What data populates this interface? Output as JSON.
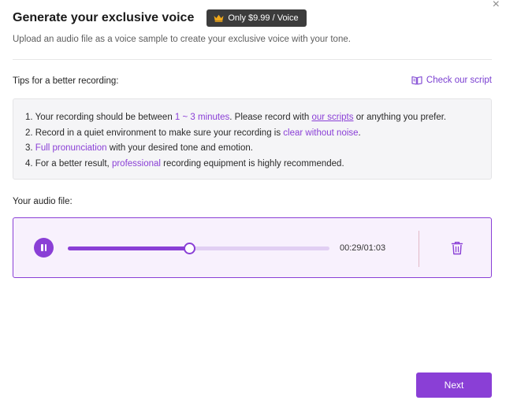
{
  "dialog": {
    "title": "Generate your exclusive voice",
    "price_badge": "Only $9.99 / Voice",
    "subtitle": "Upload an audio file as a voice sample to create your exclusive voice with your tone.",
    "close_glyph": "×"
  },
  "tips": {
    "label": "Tips for a better recording:",
    "script_link": "Check our script",
    "items": [
      {
        "n": "1.",
        "a": "Your recording should be between ",
        "hl": "1 ~ 3 minutes",
        "b": ". Please record with ",
        "link": "our scripts",
        "c": " or anything you prefer."
      },
      {
        "n": "2.",
        "a": "Record in a quiet environment to make sure your recording is ",
        "hl": "clear without noise",
        "b": "."
      },
      {
        "n": "3.",
        "hl": "Full pronunciation",
        "b": " with your desired tone and emotion."
      },
      {
        "n": "4.",
        "a": "For a better result, ",
        "hl": "professional",
        "b": " recording equipment is highly recommended."
      }
    ]
  },
  "audio": {
    "label": "Your audio file:",
    "current_time": "00:29",
    "duration": "01:03",
    "time_display": "00:29/01:03",
    "progress": 0.46,
    "state": "playing"
  },
  "footer": {
    "next_label": "Next"
  },
  "colors": {
    "accent": "#8a3fd6",
    "badge_bg": "#3c3c3c",
    "crown": "#f0a81a",
    "audio_bg": "#f8f1fd"
  },
  "icons": {
    "crown": "crown-icon",
    "book": "book-icon",
    "pause": "pause-icon",
    "trash": "trash-icon",
    "close": "close-icon"
  }
}
